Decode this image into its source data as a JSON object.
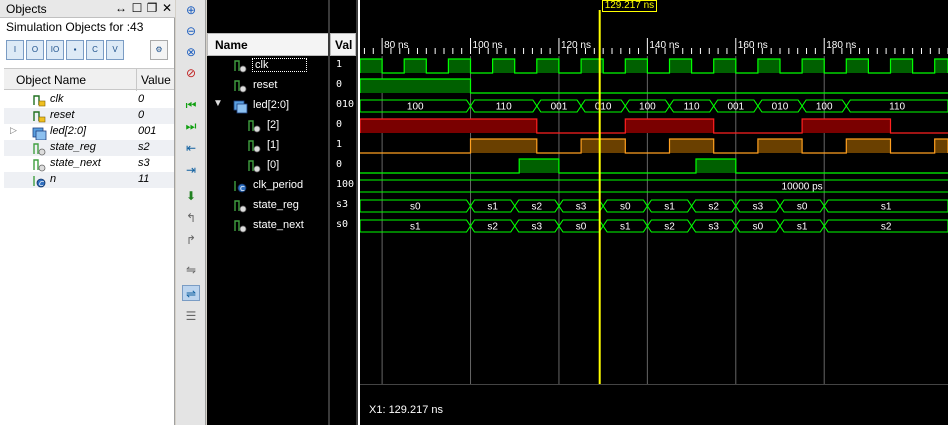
{
  "objects_panel": {
    "title": "Objects",
    "controls": [
      "↔",
      "☐",
      "❐",
      "✕"
    ],
    "subtitle": "Simulation Objects for :43",
    "toolbar_icons": [
      "input-filter-icon",
      "output-filter-icon",
      "bidir-filter-icon",
      "internal-filter-icon",
      "constant-filter-icon",
      "variable-filter-icon",
      "settings-icon"
    ],
    "columns": {
      "name": "Object Name",
      "value": "Value"
    },
    "rows": [
      {
        "name": "clk",
        "value": "0",
        "icon": "input-port-icon"
      },
      {
        "name": "reset",
        "value": "0",
        "icon": "input-port-icon"
      },
      {
        "name": "led[2:0]",
        "value": "001",
        "icon": "bus-output-icon",
        "expandable": true
      },
      {
        "name": "state_reg",
        "value": "s2",
        "icon": "signal-icon"
      },
      {
        "name": "state_next",
        "value": "s3",
        "icon": "signal-icon"
      },
      {
        "name": "n",
        "value": "11",
        "icon": "constant-icon"
      }
    ]
  },
  "wave": {
    "name_header": "Name",
    "value_header": "Val",
    "cursor_label": "129.217 ns",
    "cursor_readout": "X1: 129.217 ns",
    "signals": [
      {
        "name": "clk",
        "value": "1",
        "icon": "signal-icon"
      },
      {
        "name": "reset",
        "value": "0",
        "icon": "signal-icon"
      },
      {
        "name": "led[2:0]",
        "value": "010",
        "icon": "bus-icon"
      },
      {
        "name": "[2]",
        "value": "0",
        "icon": "signal-icon"
      },
      {
        "name": "[1]",
        "value": "1",
        "icon": "signal-icon"
      },
      {
        "name": "[0]",
        "value": "0",
        "icon": "signal-icon"
      },
      {
        "name": "clk_period",
        "value": "100",
        "icon": "constant-icon"
      },
      {
        "name": "state_reg",
        "value": "s3",
        "icon": "signal-icon"
      },
      {
        "name": "state_next",
        "value": "s0",
        "icon": "signal-icon"
      }
    ],
    "colors": {
      "clk": "#00ff00",
      "bus": "#00ff00",
      "bit2": "#ff2020",
      "bit1": "#ffa020",
      "bit0": "#00ff00",
      "cursor": "#ffff00",
      "grid": "#666666"
    }
  },
  "chart_data": {
    "type": "waveform",
    "time_unit": "ns",
    "x_range": [
      75,
      208
    ],
    "major_ticks": [
      80,
      100,
      120,
      140,
      160,
      180
    ],
    "tick_labels": [
      "80 ns",
      "100 ns",
      "120 ns",
      "140 ns",
      "160 ns",
      "180 ns"
    ],
    "cursor_time": 129.217,
    "clock_high_intervals": [
      [
        75,
        80
      ],
      [
        85,
        90
      ],
      [
        95,
        100
      ],
      [
        105,
        110
      ],
      [
        115,
        120
      ],
      [
        125,
        130
      ],
      [
        135,
        140
      ],
      [
        145,
        150
      ],
      [
        155,
        160
      ],
      [
        165,
        170
      ],
      [
        175,
        180
      ],
      [
        185,
        190
      ],
      [
        195,
        200
      ],
      [
        205,
        208
      ]
    ],
    "reset_high_intervals": [
      [
        75,
        100
      ]
    ],
    "led_bus": [
      {
        "start": 75,
        "end": 100,
        "value": "100"
      },
      {
        "start": 100,
        "end": 115,
        "value": "110"
      },
      {
        "start": 115,
        "end": 125,
        "value": "001"
      },
      {
        "start": 125,
        "end": 135,
        "value": "010"
      },
      {
        "start": 135,
        "end": 145,
        "value": "100"
      },
      {
        "start": 145,
        "end": 155,
        "value": "110"
      },
      {
        "start": 155,
        "end": 165,
        "value": "001"
      },
      {
        "start": 165,
        "end": 175,
        "value": "010"
      },
      {
        "start": 175,
        "end": 185,
        "value": "100"
      },
      {
        "start": 185,
        "end": 208,
        "value": "110"
      }
    ],
    "bit2_high_intervals": [
      [
        75,
        115
      ],
      [
        135,
        155
      ],
      [
        175,
        195
      ]
    ],
    "bit1_high_intervals": [
      [
        100,
        115
      ],
      [
        125,
        135
      ],
      [
        145,
        155
      ],
      [
        165,
        175
      ],
      [
        185,
        195
      ],
      [
        205,
        208
      ]
    ],
    "bit0_high_intervals": [
      [
        111,
        120
      ],
      [
        151,
        160
      ]
    ],
    "clk_period_label": "10000 ps",
    "state_reg_bus": [
      {
        "start": 75,
        "end": 100,
        "value": "s0"
      },
      {
        "start": 100,
        "end": 110,
        "value": "s1"
      },
      {
        "start": 110,
        "end": 120,
        "value": "s2"
      },
      {
        "start": 120,
        "end": 130,
        "value": "s3"
      },
      {
        "start": 130,
        "end": 140,
        "value": "s0"
      },
      {
        "start": 140,
        "end": 150,
        "value": "s1"
      },
      {
        "start": 150,
        "end": 160,
        "value": "s2"
      },
      {
        "start": 160,
        "end": 170,
        "value": "s3"
      },
      {
        "start": 170,
        "end": 180,
        "value": "s0"
      },
      {
        "start": 180,
        "end": 208,
        "value": "s1"
      }
    ],
    "state_next_bus": [
      {
        "start": 75,
        "end": 100,
        "value": "s1"
      },
      {
        "start": 100,
        "end": 110,
        "value": "s2"
      },
      {
        "start": 110,
        "end": 120,
        "value": "s3"
      },
      {
        "start": 120,
        "end": 130,
        "value": "s0"
      },
      {
        "start": 130,
        "end": 140,
        "value": "s1"
      },
      {
        "start": 140,
        "end": 150,
        "value": "s2"
      },
      {
        "start": 150,
        "end": 160,
        "value": "s3"
      },
      {
        "start": 160,
        "end": 170,
        "value": "s0"
      },
      {
        "start": 170,
        "end": 180,
        "value": "s1"
      },
      {
        "start": 180,
        "end": 208,
        "value": "s2"
      }
    ]
  }
}
